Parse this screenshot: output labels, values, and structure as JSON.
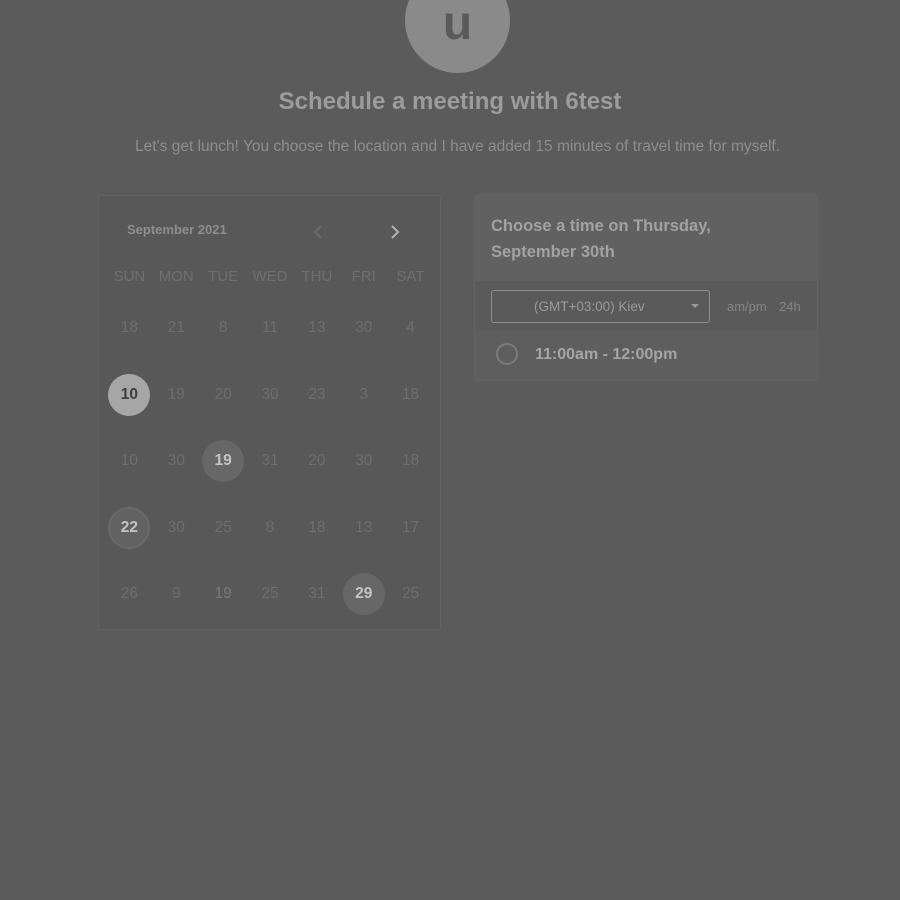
{
  "host": {
    "avatar_initial": "u",
    "title": "Schedule a meeting with 6test",
    "description": "Let’s get lunch! You choose the location and I have added 15 minutes of travel time for myself."
  },
  "calendar": {
    "month_label": "September 2021",
    "prev_icon": "chevron-left-icon",
    "next_icon": "chevron-right-icon",
    "weekdays": [
      "SUN",
      "MON",
      "TUE",
      "WED",
      "THU",
      "FRI",
      "SAT"
    ],
    "weeks": [
      [
        {
          "label": "18",
          "state": "disabled"
        },
        {
          "label": "21",
          "state": "disabled"
        },
        {
          "label": "8",
          "state": "disabled"
        },
        {
          "label": "11",
          "state": "disabled"
        },
        {
          "label": "13",
          "state": "disabled"
        },
        {
          "label": "30",
          "state": "disabled"
        },
        {
          "label": "4",
          "state": "disabled"
        }
      ],
      [
        {
          "label": "10",
          "state": "selected"
        },
        {
          "label": "19",
          "state": "disabled"
        },
        {
          "label": "20",
          "state": "disabled"
        },
        {
          "label": "30",
          "state": "disabled"
        },
        {
          "label": "23",
          "state": "disabled"
        },
        {
          "label": "3",
          "state": "disabled"
        },
        {
          "label": "18",
          "state": "disabled"
        }
      ],
      [
        {
          "label": "10",
          "state": "disabled"
        },
        {
          "label": "30",
          "state": "disabled"
        },
        {
          "label": "19",
          "state": "available"
        },
        {
          "label": "31",
          "state": "disabled"
        },
        {
          "label": "20",
          "state": "disabled"
        },
        {
          "label": "30",
          "state": "disabled"
        },
        {
          "label": "18",
          "state": "disabled"
        }
      ],
      [
        {
          "label": "22",
          "state": "today"
        },
        {
          "label": "30",
          "state": "disabled"
        },
        {
          "label": "25",
          "state": "disabled"
        },
        {
          "label": "8",
          "state": "disabled"
        },
        {
          "label": "18",
          "state": "disabled"
        },
        {
          "label": "13",
          "state": "disabled"
        },
        {
          "label": "17",
          "state": "disabled"
        }
      ],
      [
        {
          "label": "26",
          "state": "disabled"
        },
        {
          "label": "9",
          "state": "disabled"
        },
        {
          "label": "19",
          "state": "disabled-light"
        },
        {
          "label": "25",
          "state": "disabled"
        },
        {
          "label": "31",
          "state": "disabled"
        },
        {
          "label": "29",
          "state": "available"
        },
        {
          "label": "25",
          "state": "disabled"
        }
      ]
    ]
  },
  "time_panel": {
    "heading": "Choose a time on Thursday, September 30th",
    "timezone": "(GMT+03:00) Kiev",
    "format_ampm": "am/pm",
    "format_24h": "24h",
    "slots": [
      "11:00am - 12:00pm"
    ]
  },
  "colors": {
    "background": "#5b5b5b",
    "selected_day": "#a6a6a6",
    "available_day": "#676767"
  }
}
